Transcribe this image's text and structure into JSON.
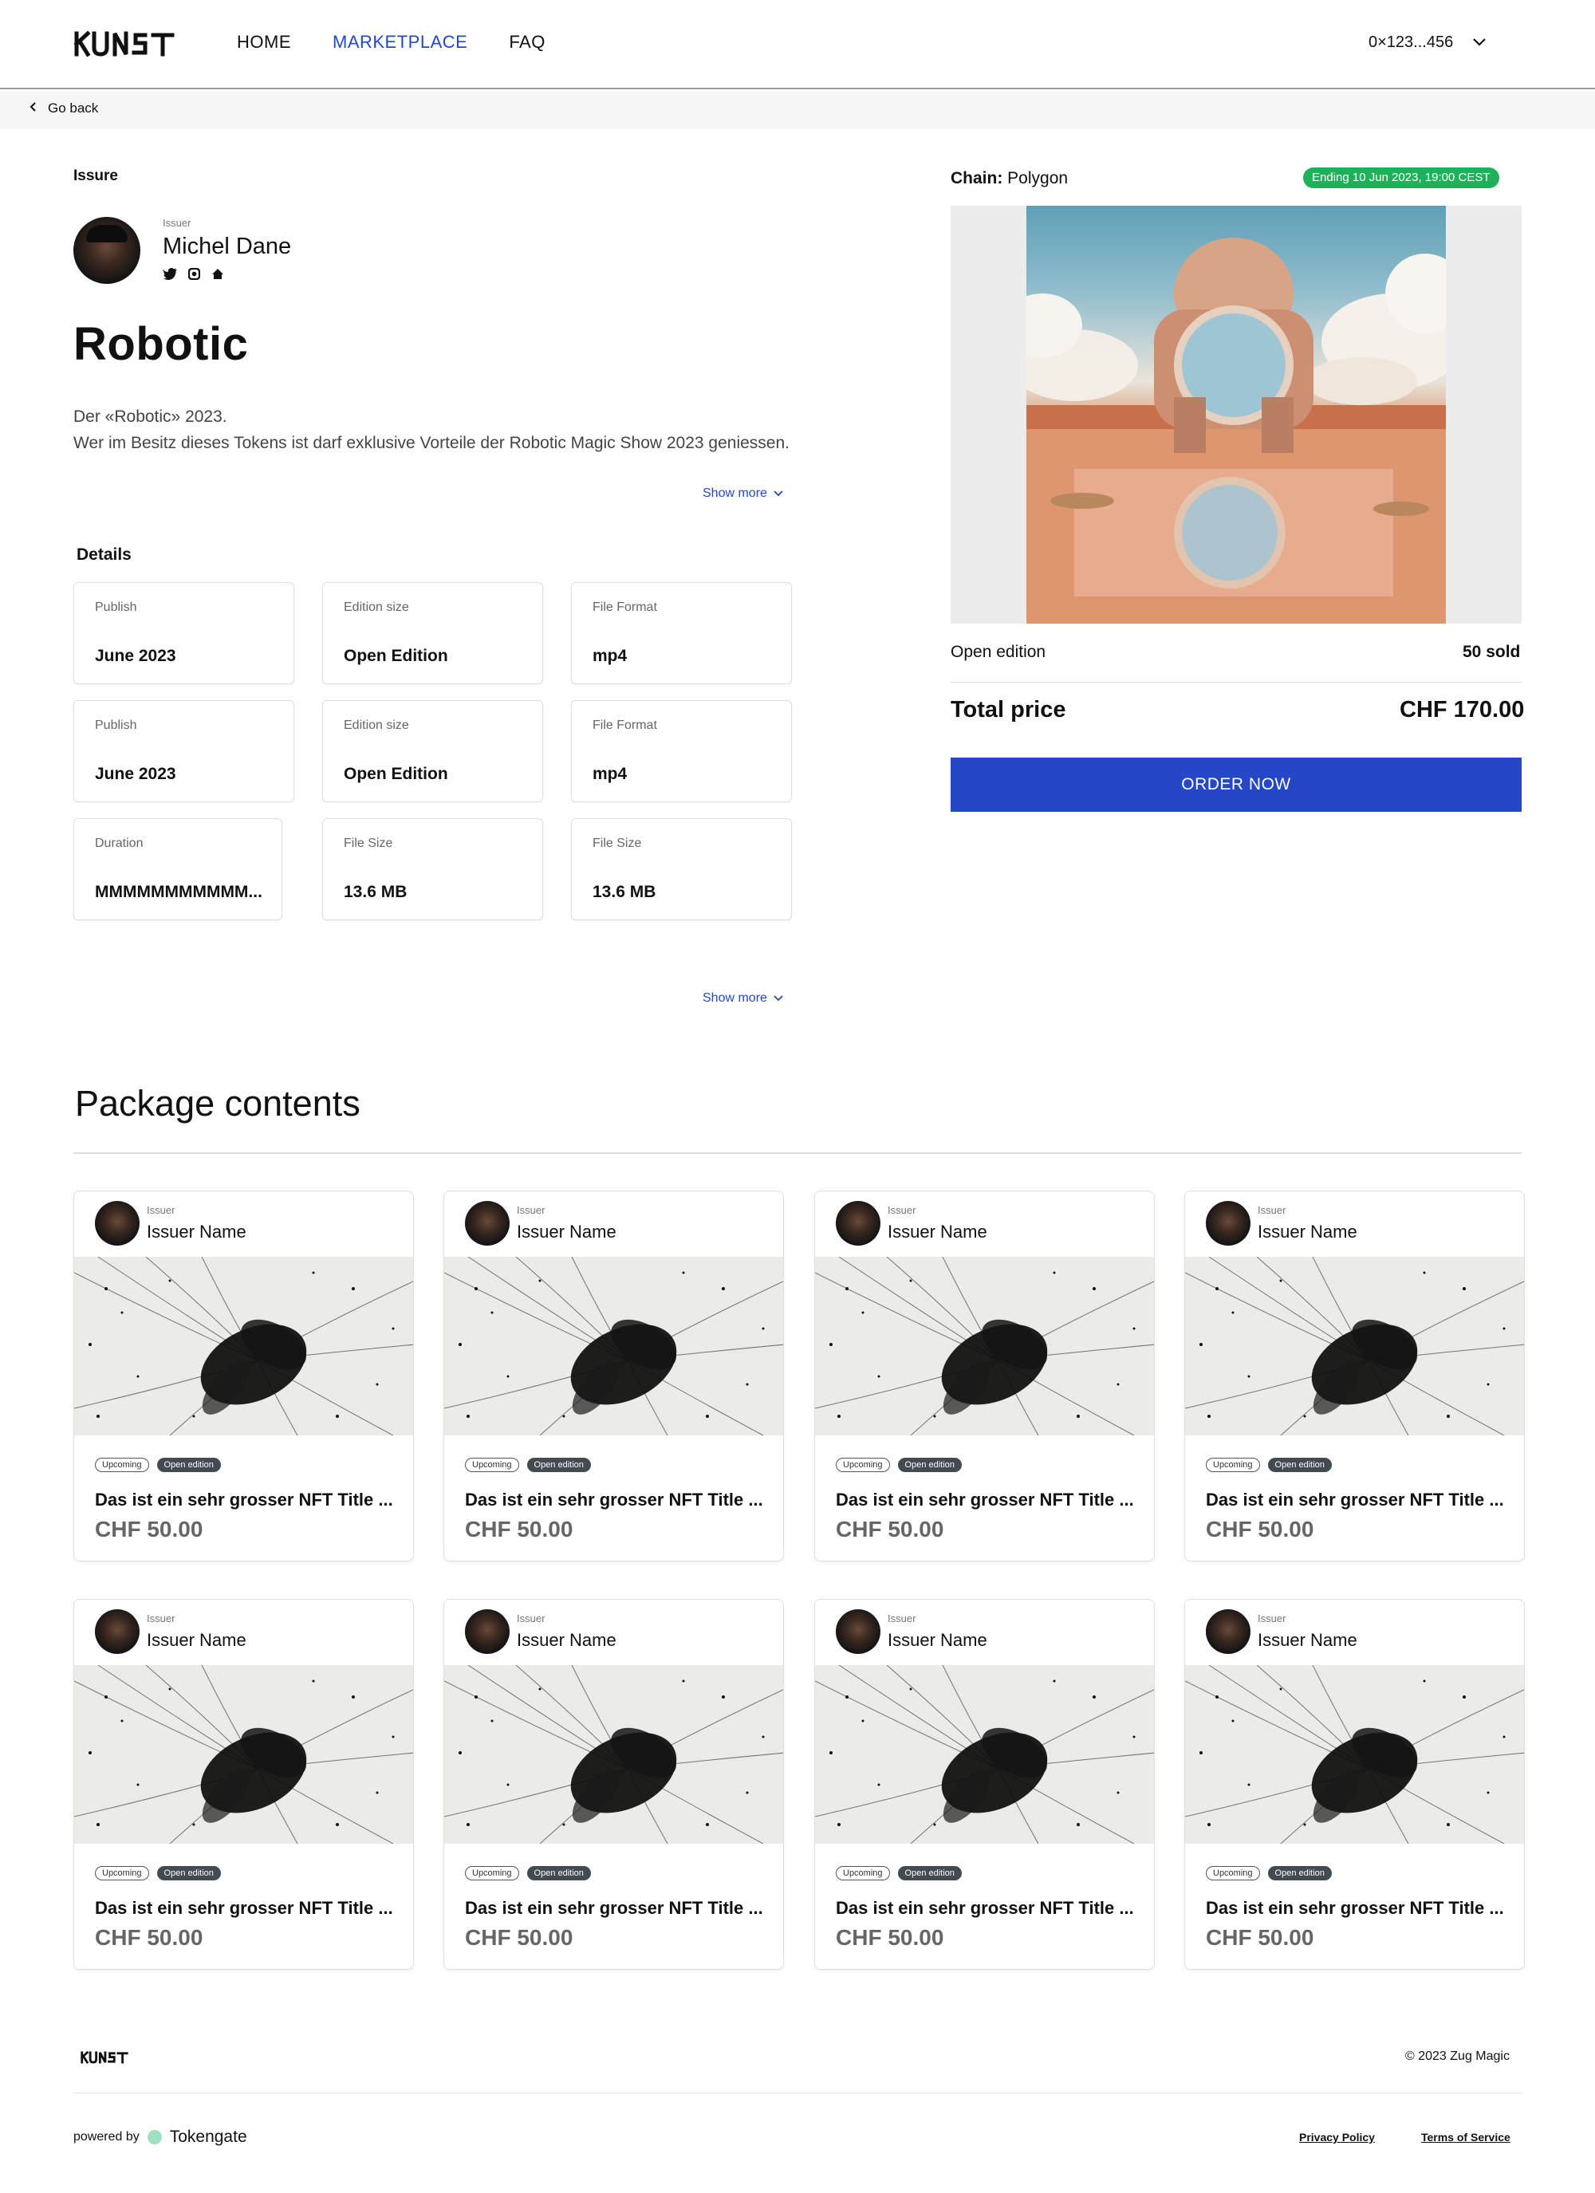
{
  "header": {
    "logo_text": "KUNST",
    "nav": [
      {
        "label": "HOME"
      },
      {
        "label": "MARKETPLACE"
      },
      {
        "label": "FAQ"
      }
    ],
    "wallet": "0×123...456"
  },
  "subbar": {
    "back_label": "Go back"
  },
  "issue": {
    "section_label": "Issure",
    "issuer_small": "Issuer",
    "issuer_name": "Michel Dane",
    "title": "Robotic",
    "description_line1": "Der «Robotic» 2023.",
    "description_line2": "Wer im Besitz dieses Tokens ist darf exklusive Vorteile der Robotic Magic Show 2023 geniessen.",
    "show_more": "Show more"
  },
  "details": {
    "label": "Details",
    "cards": [
      {
        "key": "Publish",
        "value": "June 2023"
      },
      {
        "key": "Edition size",
        "value": "Open Edition"
      },
      {
        "key": "File Format",
        "value": "mp4"
      },
      {
        "key": "Publish",
        "value": "June 2023"
      },
      {
        "key": "Edition size",
        "value": "Open Edition"
      },
      {
        "key": "File Format",
        "value": "mp4"
      },
      {
        "key": "Duration",
        "value": "MMMMMMMMMMM..."
      },
      {
        "key": "File Size",
        "value": "13.6 MB"
      },
      {
        "key": "File Size",
        "value": "13.6 MB"
      }
    ],
    "show_more": "Show more"
  },
  "purchase": {
    "chain_label": "Chain:",
    "chain_value": "Polygon",
    "ending": "Ending 10 Jun 2023, 19:00 CEST",
    "edition_label": "Open edition",
    "sold": "50 sold",
    "total_label": "Total price",
    "total_price": "CHF 170.00",
    "order_button": "ORDER NOW"
  },
  "package": {
    "title": "Package contents",
    "items": [
      {
        "issuer_small": "Issuer",
        "issuer_name": "Issuer Name",
        "tag_status": "Upcoming",
        "tag_edition": "Open edition",
        "title": "Das ist ein sehr grosser NFT Title ...",
        "price": "CHF 50.00"
      },
      {
        "issuer_small": "Issuer",
        "issuer_name": "Issuer Name",
        "tag_status": "Upcoming",
        "tag_edition": "Open edition",
        "title": "Das ist ein sehr grosser NFT Title ...",
        "price": "CHF 50.00"
      },
      {
        "issuer_small": "Issuer",
        "issuer_name": "Issuer Name",
        "tag_status": "Upcoming",
        "tag_edition": "Open edition",
        "title": "Das ist ein sehr grosser NFT Title ...",
        "price": "CHF 50.00"
      },
      {
        "issuer_small": "Issuer",
        "issuer_name": "Issuer Name",
        "tag_status": "Upcoming",
        "tag_edition": "Open edition",
        "title": "Das ist ein sehr grosser NFT Title ...",
        "price": "CHF 50.00"
      },
      {
        "issuer_small": "Issuer",
        "issuer_name": "Issuer Name",
        "tag_status": "Upcoming",
        "tag_edition": "Open edition",
        "title": "Das ist ein sehr grosser NFT Title ...",
        "price": "CHF 50.00"
      },
      {
        "issuer_small": "Issuer",
        "issuer_name": "Issuer Name",
        "tag_status": "Upcoming",
        "tag_edition": "Open edition",
        "title": "Das ist ein sehr grosser NFT Title ...",
        "price": "CHF 50.00"
      },
      {
        "issuer_small": "Issuer",
        "issuer_name": "Issuer Name",
        "tag_status": "Upcoming",
        "tag_edition": "Open edition",
        "title": "Das ist ein sehr grosser NFT Title ...",
        "price": "CHF 50.00"
      },
      {
        "issuer_small": "Issuer",
        "issuer_name": "Issuer Name",
        "tag_status": "Upcoming",
        "tag_edition": "Open edition",
        "title": "Das ist ein sehr grosser NFT Title ...",
        "price": "CHF 50.00"
      }
    ]
  },
  "footer": {
    "copyright": "© 2023 Zug Magic",
    "powered_by": "powered by",
    "powered_brand": "Tokengate",
    "privacy": "Privacy Policy",
    "terms": "Terms of Service"
  },
  "colors": {
    "accent": "#2447c8",
    "badge_green": "#1fb15a",
    "tag_dark": "#444a52"
  },
  "icons": [
    "chevron-left-icon",
    "chevron-down-icon",
    "twitter-icon",
    "instagram-icon",
    "home-icon"
  ]
}
